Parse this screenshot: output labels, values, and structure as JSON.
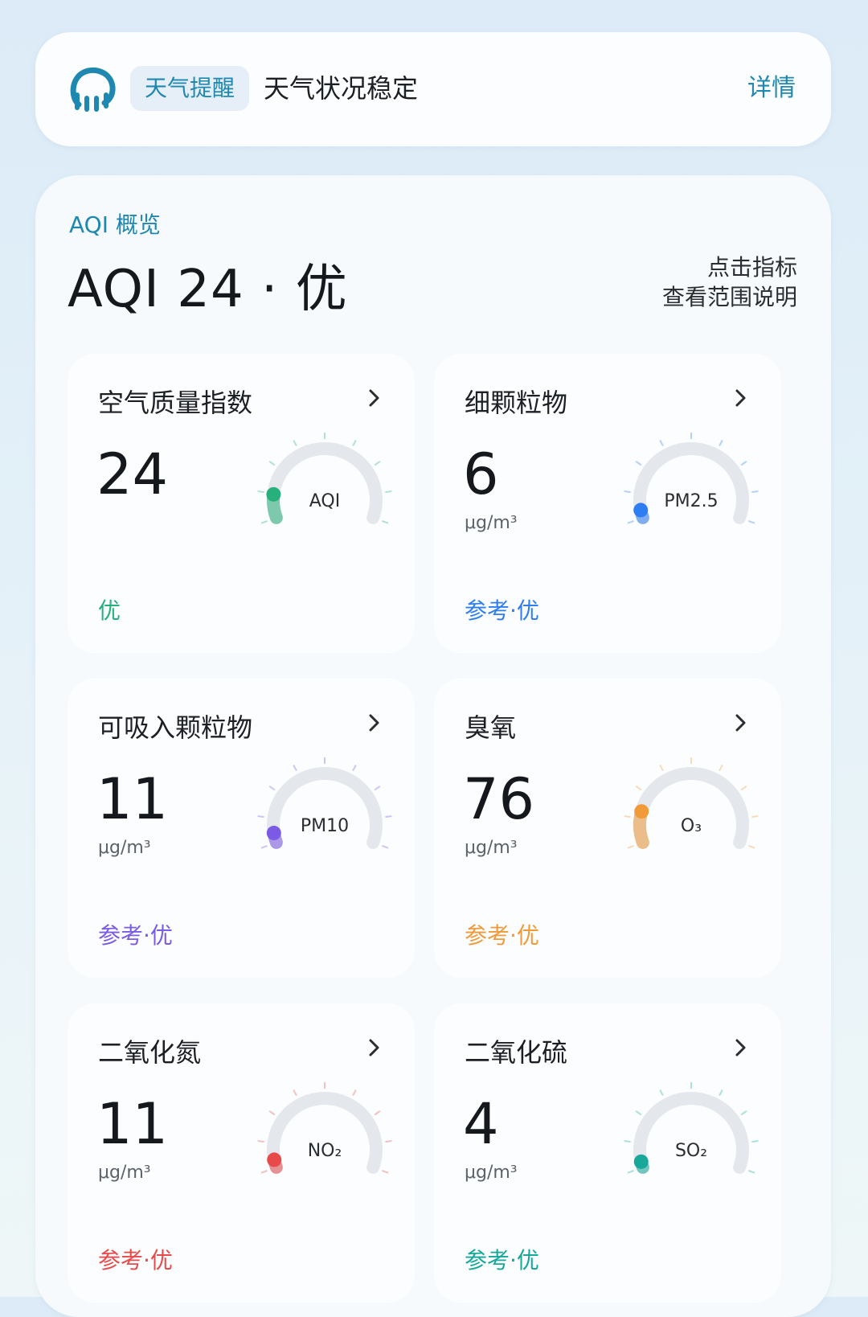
{
  "alert": {
    "tag": "天气提醒",
    "text": "天气状况稳定",
    "more": "详情",
    "icon": "weather-alert-logo-icon",
    "accent": "#1f88b0"
  },
  "overview": {
    "section_title": "AQI 概览",
    "headline": "AQI 24 · 优",
    "hint_line1": "点击指标",
    "hint_line2": "查看范围说明"
  },
  "metrics": [
    {
      "title": "空气质量指数",
      "value": "24",
      "unit": "",
      "gauge_label": "AQI",
      "status": "优",
      "color": "#27b07c",
      "level": 0.12
    },
    {
      "title": "细颗粒物",
      "value": "6",
      "unit": "μg/m³",
      "gauge_label": "PM2.5",
      "status": "参考·优",
      "color": "#2e7ef2",
      "level": 0.04
    },
    {
      "title": "可吸入颗粒物",
      "value": "11",
      "unit": "μg/m³",
      "gauge_label": "PM10",
      "status": "参考·优",
      "color": "#7b5ae6",
      "level": 0.05
    },
    {
      "title": "臭氧",
      "value": "76",
      "unit": "μg/m³",
      "gauge_label": "O₃",
      "status": "参考·优",
      "color": "#f09a3a",
      "level": 0.16
    },
    {
      "title": "二氧化氮",
      "value": "11",
      "unit": "μg/m³",
      "gauge_label": "NO₂",
      "status": "参考·优",
      "color": "#e84a4a",
      "level": 0.04
    },
    {
      "title": "二氧化硫",
      "value": "4",
      "unit": "μg/m³",
      "gauge_label": "SO₂",
      "status": "参考·优",
      "color": "#17a89a",
      "level": 0.03
    }
  ]
}
